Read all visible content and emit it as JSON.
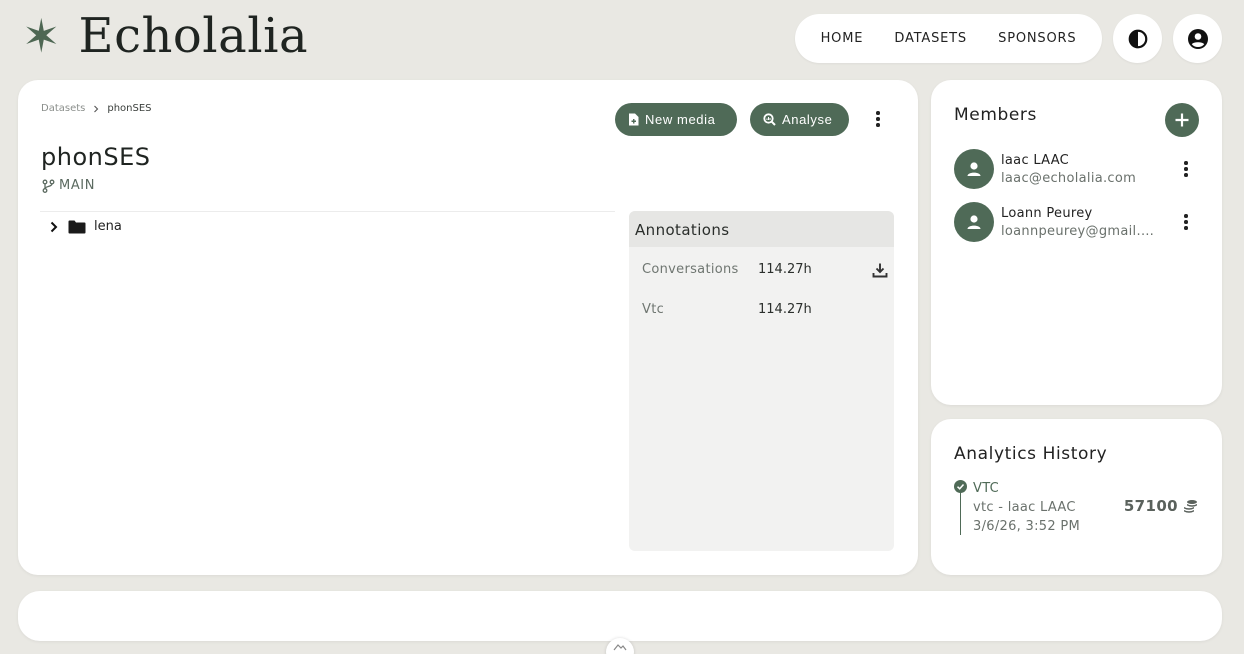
{
  "brand": {
    "name": "Echolalia",
    "logo_glyph": "✶",
    "accent": "#4f6a57"
  },
  "nav": {
    "items": [
      "HOME",
      "DATASETS",
      "SPONSORS"
    ]
  },
  "breadcrumb": {
    "root": "Datasets",
    "current": "phonSES"
  },
  "dataset": {
    "title": "phonSES",
    "branch": "MAIN"
  },
  "actions": {
    "new_media": "New media",
    "analyse": "Analyse"
  },
  "tree": {
    "items": [
      {
        "name": "lena",
        "type": "folder"
      }
    ]
  },
  "annotations": {
    "title": "Annotations",
    "rows": [
      {
        "name": "Conversations",
        "value": "114.27h",
        "downloadable": true
      },
      {
        "name": "Vtc",
        "value": "114.27h",
        "downloadable": false
      }
    ]
  },
  "members": {
    "title": "Members",
    "list": [
      {
        "name": "laac LAAC",
        "email": "laac@echolalia.com"
      },
      {
        "name": "Loann Peurey",
        "email": "loannpeurey@gmail.c..."
      }
    ]
  },
  "analytics": {
    "title": "Analytics History",
    "entries": [
      {
        "type": "VTC",
        "subtitle": "vtc - laac LAAC",
        "date": "3/6/26, 3:52 PM",
        "credits": "57100",
        "status": "done"
      }
    ]
  }
}
